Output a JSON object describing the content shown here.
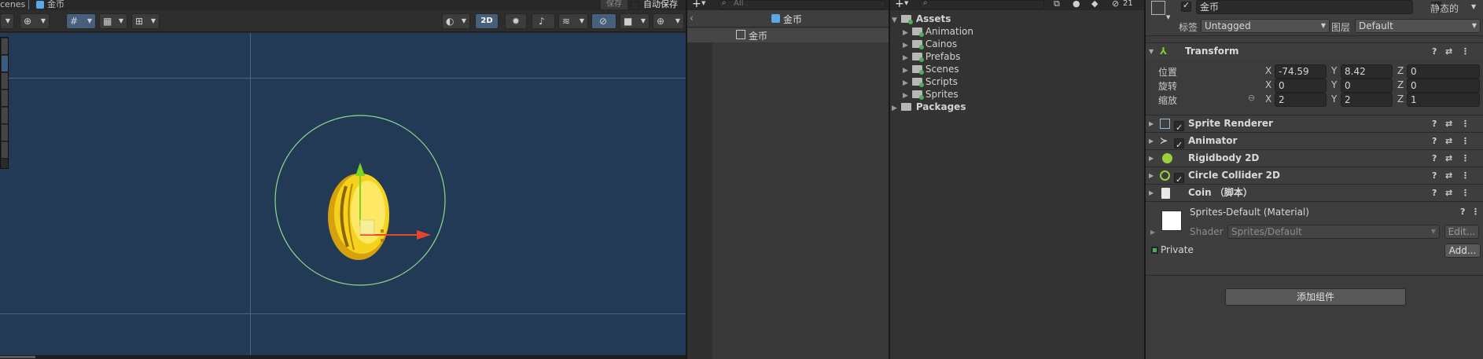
{
  "scene": {
    "tabs": [
      {
        "label": "cenes"
      },
      {
        "label": "金币"
      }
    ],
    "save_label": "保存",
    "autosave_label": "自动保存",
    "mode_2d_label": "2D"
  },
  "hierarchy": {
    "search_placeholder": "All",
    "scene_name": "金币",
    "items": [
      {
        "label": "金币"
      }
    ]
  },
  "project": {
    "search_placeholder": "",
    "root": "Assets",
    "folders": [
      {
        "label": "Animation"
      },
      {
        "label": "Cainos"
      },
      {
        "label": "Prefabs"
      },
      {
        "label": "Scenes"
      },
      {
        "label": "Scripts"
      },
      {
        "label": "Sprites"
      }
    ],
    "packages": "Packages",
    "count": "21"
  },
  "inspector": {
    "object_name": "金币",
    "static_label": "静态的",
    "tag_label": "标签",
    "tag_value": "Untagged",
    "layer_label": "图层",
    "layer_value": "Default",
    "transform": {
      "title": "Transform",
      "position_label": "位置",
      "rotation_label": "旋转",
      "scale_label": "缩放",
      "position": {
        "x": "-74.59",
        "y": "8.42",
        "z": "0"
      },
      "rotation": {
        "x": "0",
        "y": "0",
        "z": "0"
      },
      "scale": {
        "x": "2",
        "y": "2",
        "z": "1"
      }
    },
    "components": [
      {
        "label": "Sprite Renderer",
        "checked": true
      },
      {
        "label": "Animator",
        "checked": true
      },
      {
        "label": "Rigidbody 2D",
        "checked": false
      },
      {
        "label": "Circle Collider 2D",
        "checked": true
      },
      {
        "label": "Coin （脚本）",
        "checked": false
      }
    ],
    "material": {
      "name": "Sprites-Default (Material)",
      "shader_label": "Shader",
      "shader_value": "Sprites/Default",
      "edit_label": "Edit...",
      "private_label": "Private",
      "add_label": "Add..."
    },
    "add_component_label": "添加组件"
  },
  "colors": {
    "scene_bg": "#223a55",
    "grid": "#4a6580",
    "collider": "#8fd98f",
    "coin": "#f5d31c",
    "gizmo_y": "#7ed321",
    "gizmo_x": "#e8452f",
    "component_active": "#4caf50"
  }
}
